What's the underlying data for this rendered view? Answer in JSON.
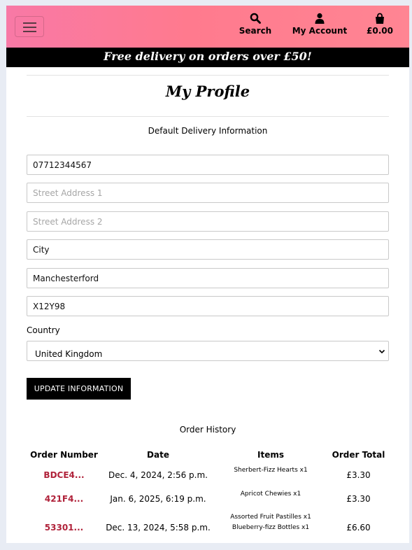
{
  "header": {
    "menu_icon": "hamburger-icon",
    "search": {
      "label": "Search",
      "icon": "search-icon"
    },
    "account": {
      "label": "My Account",
      "icon": "user-icon"
    },
    "cart": {
      "label": "£0.00",
      "icon": "shopping-bag-icon"
    }
  },
  "banner": {
    "text": "Free delivery on orders over £50!"
  },
  "profile": {
    "title": "My Profile",
    "delivery_heading": "Default Delivery Information",
    "fields": {
      "phone": {
        "value": "07712344567",
        "placeholder": ""
      },
      "street1": {
        "value": "",
        "placeholder": "Street Address 1"
      },
      "street2": {
        "value": "",
        "placeholder": "Street Address 2"
      },
      "city": {
        "value": "City",
        "placeholder": ""
      },
      "county": {
        "value": "Manchesterford",
        "placeholder": ""
      },
      "postcode": {
        "value": "X12Y98",
        "placeholder": ""
      }
    },
    "country_label": "Country",
    "country_value": "United Kingdom",
    "update_button": "UPDATE INFORMATION"
  },
  "orders": {
    "heading": "Order History",
    "columns": [
      "Order Number",
      "Date",
      "Items",
      "Order Total"
    ],
    "rows": [
      {
        "number": "BDCE4...",
        "date": "Dec. 4, 2024, 2:56 p.m.",
        "items": [
          "Sherbert-Fizz Hearts x1"
        ],
        "total": "£3.30"
      },
      {
        "number": "421F4...",
        "date": "Jan. 6, 2025, 6:19 p.m.",
        "items": [
          "Apricot Chewies x1"
        ],
        "total": "£3.30"
      },
      {
        "number": "53301...",
        "date": "Dec. 13, 2024, 5:58 p.m.",
        "items": [
          "Assorted Fruit Pastilles x1",
          "Blueberry-fizz Bottles x1"
        ],
        "total": "£6.60"
      }
    ]
  },
  "colors": {
    "header_gradient_start": "#f879a6",
    "header_gradient_end": "#ff8593",
    "order_link": "#b0223a"
  }
}
